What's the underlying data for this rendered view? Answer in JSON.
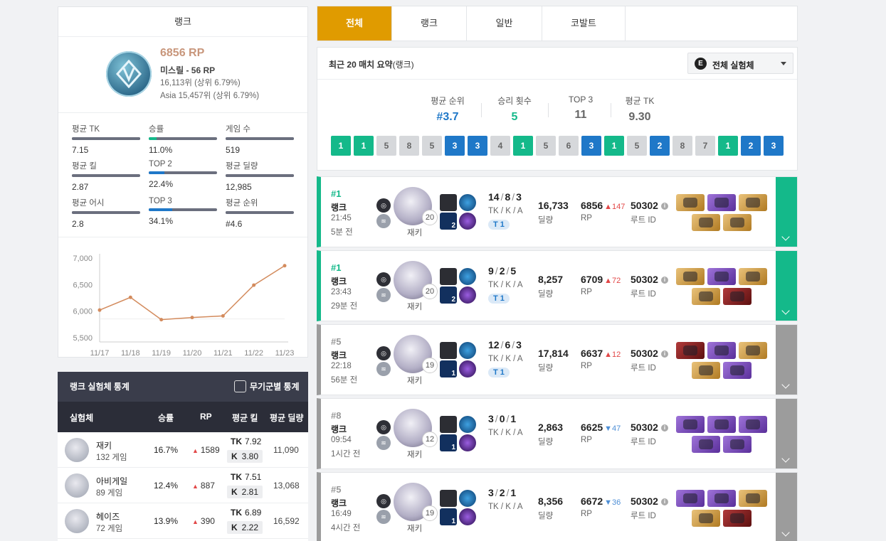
{
  "rank_card": {
    "title": "랭크",
    "rp": "6856 RP",
    "tier": "미스릴 - 56 RP",
    "rank_global": "16,113위 (상위 6.79%)",
    "rank_region": "Asia 15,457위 (상위 6.79%)",
    "stats": [
      {
        "label": "평균 TK",
        "value": "7.15",
        "fill": 1.0
      },
      {
        "label": "승률",
        "value": "11.0%",
        "fill": 0.11
      },
      {
        "label": "게임 수",
        "value": "519",
        "fill": 1.0
      },
      {
        "label": "평균 킬",
        "value": "2.87",
        "fill": 0.9
      },
      {
        "label": "TOP 2",
        "value": "22.4%",
        "fill": 0.224
      },
      {
        "label": "평균 딜량",
        "value": "12,985",
        "fill": 1.0
      },
      {
        "label": "평균 어시",
        "value": "2.8",
        "fill": 0.55
      },
      {
        "label": "TOP 3",
        "value": "34.1%",
        "fill": 0.341
      },
      {
        "label": "평균 순위",
        "value": "#4.6",
        "fill": 0.65
      }
    ]
  },
  "chart_data": {
    "type": "line",
    "categories": [
      "11/17",
      "11/18",
      "11/19",
      "11/20",
      "11/21",
      "11/22",
      "11/23"
    ],
    "values": [
      6020,
      6260,
      5840,
      5880,
      5910,
      6490,
      6856
    ],
    "yticks": [
      "7,000",
      "6,500",
      "6,000",
      "5,500"
    ],
    "ylim": [
      5500,
      7000
    ],
    "color": "#d38b5d"
  },
  "stat_table": {
    "title": "랭크 실험체 통계",
    "toggle_label": "무기군별 통계",
    "columns": [
      "실험체",
      "승률",
      "RP",
      "평균 킬",
      "평균 딜량"
    ],
    "rows": [
      {
        "name": "재키",
        "games": "132 게임",
        "winrate": "16.7%",
        "rp": "1589",
        "tk_label": "TK",
        "tk": "7.92",
        "k_label": "K",
        "k": "3.80",
        "dmg": "11,090"
      },
      {
        "name": "아비게일",
        "games": "89 게임",
        "winrate": "12.4%",
        "rp": "887",
        "tk_label": "TK",
        "tk": "7.51",
        "k_label": "K",
        "k": "2.81",
        "dmg": "13,068"
      },
      {
        "name": "헤이즈",
        "games": "72 게임",
        "winrate": "13.9%",
        "rp": "390",
        "tk_label": "TK",
        "tk": "6.89",
        "k_label": "K",
        "k": "2.22",
        "dmg": "16,592"
      }
    ]
  },
  "tabs": [
    {
      "label": "전체",
      "active": true
    },
    {
      "label": "랭크",
      "active": false
    },
    {
      "label": "일반",
      "active": false
    },
    {
      "label": "코발트",
      "active": false
    }
  ],
  "summary": {
    "title_bold": "최근 20 매치 요약",
    "title_sub": "(랭크)",
    "dropdown": "전체 실험체",
    "kpis": [
      {
        "label": "평균 순위",
        "value": "#3.7",
        "color": "#1f78c8"
      },
      {
        "label": "승리 횟수",
        "value": "5",
        "color": "#14b98a"
      },
      {
        "label": "TOP 3",
        "value": "11",
        "color": "#666666"
      },
      {
        "label": "평균 TK",
        "value": "9.30",
        "color": "#666666"
      }
    ],
    "placements": [
      "1",
      "1",
      "5",
      "8",
      "5",
      "3",
      "3",
      "4",
      "1",
      "5",
      "6",
      "3",
      "1",
      "5",
      "2",
      "8",
      "7",
      "1",
      "2",
      "3"
    ]
  },
  "matches": [
    {
      "place": "#1",
      "mode": "랭크",
      "time": "21:45",
      "ago": "5분 전",
      "level": "20",
      "char": "재키",
      "skill_lv": "2",
      "k": "14",
      "d": "8",
      "a": "3",
      "kda_label": "TK / K / A",
      "tier": "T 1",
      "dmg": "16,733",
      "dmg_label": "딜량",
      "rp": "6856",
      "rp_delta": "147",
      "rp_dir": "up",
      "rp_label": "RP",
      "route": "50302",
      "route_label": "루트 ID",
      "items": [
        "gold",
        "purple",
        "gold",
        "gold",
        "gold"
      ],
      "win": true
    },
    {
      "place": "#1",
      "mode": "랭크",
      "time": "23:43",
      "ago": "29분 전",
      "level": "20",
      "char": "재키",
      "skill_lv": "2",
      "k": "9",
      "d": "2",
      "a": "5",
      "kda_label": "TK / K / A",
      "tier": "T 1",
      "dmg": "8,257",
      "dmg_label": "딜량",
      "rp": "6709",
      "rp_delta": "72",
      "rp_dir": "up",
      "rp_label": "RP",
      "route": "50302",
      "route_label": "루트 ID",
      "items": [
        "gold",
        "purple",
        "gold",
        "gold",
        "red"
      ],
      "win": true
    },
    {
      "place": "#5",
      "mode": "랭크",
      "time": "22:18",
      "ago": "56분 전",
      "level": "19",
      "char": "재키",
      "skill_lv": "1",
      "k": "12",
      "d": "6",
      "a": "3",
      "kda_label": "TK / K / A",
      "tier": "T 1",
      "dmg": "17,814",
      "dmg_label": "딜량",
      "rp": "6637",
      "rp_delta": "12",
      "rp_dir": "up",
      "rp_label": "RP",
      "route": "50302",
      "route_label": "루트 ID",
      "items": [
        "red",
        "purple",
        "gold",
        "gold",
        "purple"
      ],
      "win": false
    },
    {
      "place": "#8",
      "mode": "랭크",
      "time": "09:54",
      "ago": "1시간 전",
      "level": "12",
      "char": "재키",
      "skill_lv": "1",
      "k": "3",
      "d": "0",
      "a": "1",
      "kda_label": "TK / K / A",
      "tier": "",
      "dmg": "2,863",
      "dmg_label": "딜량",
      "rp": "6625",
      "rp_delta": "47",
      "rp_dir": "down",
      "rp_label": "RP",
      "route": "50302",
      "route_label": "루트 ID",
      "items": [
        "purple",
        "purple",
        "purple",
        "purple",
        "purple"
      ],
      "win": false
    },
    {
      "place": "#5",
      "mode": "랭크",
      "time": "16:49",
      "ago": "4시간 전",
      "level": "19",
      "char": "재키",
      "skill_lv": "1",
      "k": "3",
      "d": "2",
      "a": "1",
      "kda_label": "TK / K / A",
      "tier": "",
      "dmg": "8,356",
      "dmg_label": "딜량",
      "rp": "6672",
      "rp_delta": "36",
      "rp_dir": "down",
      "rp_label": "RP",
      "route": "50302",
      "route_label": "루트 ID",
      "items": [
        "purple",
        "purple",
        "gold",
        "gold",
        "red"
      ],
      "win": false
    }
  ]
}
